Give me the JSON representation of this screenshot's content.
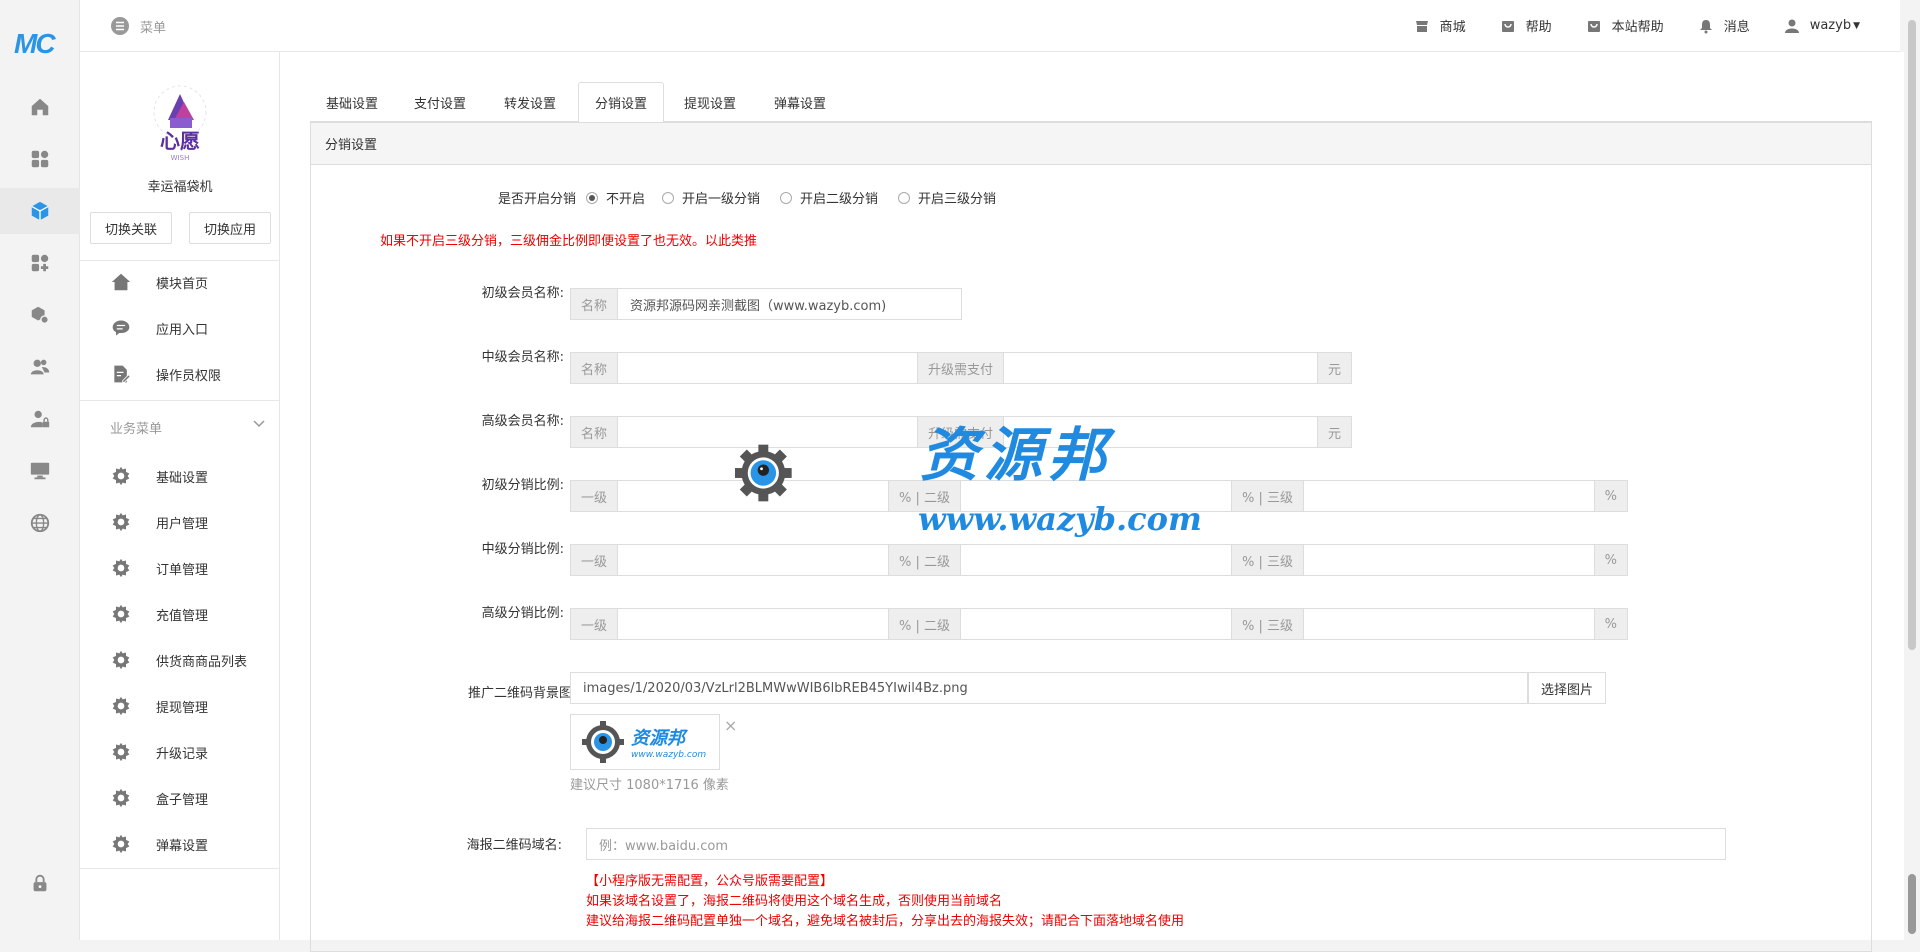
{
  "rail": {
    "logo": "MC",
    "items": [
      "home-icon",
      "dashboard-icon",
      "cube-icon",
      "apps-icon",
      "plugin-icon",
      "users-icon",
      "user-lock-icon",
      "monitor-icon",
      "globe-icon",
      "lock-icon"
    ],
    "active_index": 2
  },
  "sidebar": {
    "app_name": "幸运福袋机",
    "switch_link_label": "切换关联",
    "switch_app_label": "切换应用",
    "top_items": [
      {
        "label": "模块首页",
        "icon": "home-icon"
      },
      {
        "label": "应用入口",
        "icon": "chat-icon"
      },
      {
        "label": "操作员权限",
        "icon": "doc-edit-icon"
      }
    ],
    "group_title": "业务菜单",
    "group_items": [
      "基础设置",
      "用户管理",
      "订单管理",
      "充值管理",
      "供货商商品列表",
      "提现管理",
      "升级记录",
      "盒子管理",
      "弹幕设置"
    ]
  },
  "topbar": {
    "menu_label": "菜单",
    "links": [
      {
        "label": "商城",
        "icon": "store-icon"
      },
      {
        "label": "帮助",
        "icon": "bag-icon"
      },
      {
        "label": "本站帮助",
        "icon": "bag-icon"
      },
      {
        "label": "消息",
        "icon": "bell-icon"
      },
      {
        "label": "wazyb",
        "icon": "user-icon"
      }
    ]
  },
  "tabs": [
    "基础设置",
    "支付设置",
    "转发设置",
    "分销设置",
    "提现设置",
    "弹幕设置"
  ],
  "active_tab": 3,
  "panel": {
    "title": "分销设置",
    "enable_label": "是否开启分销",
    "enable_options": [
      "不开启",
      "开启一级分销",
      "开启二级分销",
      "开启三级分销"
    ],
    "enable_selected": 0,
    "warning": "如果不开启三级分销，三级佣金比例即便设置了也无效。以此类推",
    "primary_member_label": "初级会员名称:",
    "primary_member_addon": "名称",
    "primary_member_value": "资源邦源码网亲测截图（www.wazyb.com)",
    "mid_member_label": "中级会员名称:",
    "senior_member_label": "高级会员名称:",
    "name_addon": "名称",
    "upgrade_addon": "升级需支付",
    "yuan_addon": "元",
    "ratio_rows": [
      "初级分销比例:",
      "中级分销比例:",
      "高级分销比例:"
    ],
    "level1": "一级",
    "pct_level2": "% | 二级",
    "pct_level3": "% | 三级",
    "pct": "%",
    "qr_bg_label": "推广二维码背景图",
    "qr_bg_value": "images/1/2020/03/VzLrl2BLMWwWIB6lbREB45YIwil4Bz.png",
    "pick_image": "选择图片",
    "thumb_close": "×",
    "size_hint": "建议尺寸 1080*1716 像素",
    "poster_domain_label": "海报二维码域名:",
    "poster_domain_placeholder": "例：www.baidu.com",
    "notes": [
      "【小程序版无需配置，公众号版需要配置】",
      "如果该域名设置了，海报二维码将使用这个域名生成，否则使用当前域名",
      "建议给海报二维码配置单独一个域名，避免域名被封后，分享出去的海报失效；请配合下面落地域名使用"
    ]
  },
  "watermark": {
    "text": "资源邦",
    "url": "www.wazyb.com",
    "thumb_text": "资源邦",
    "thumb_url": "www.wazyb.com"
  },
  "colors": {
    "accent": "#2a94e6",
    "warning": "#ee0000",
    "watermark": "#1f8ae0"
  }
}
